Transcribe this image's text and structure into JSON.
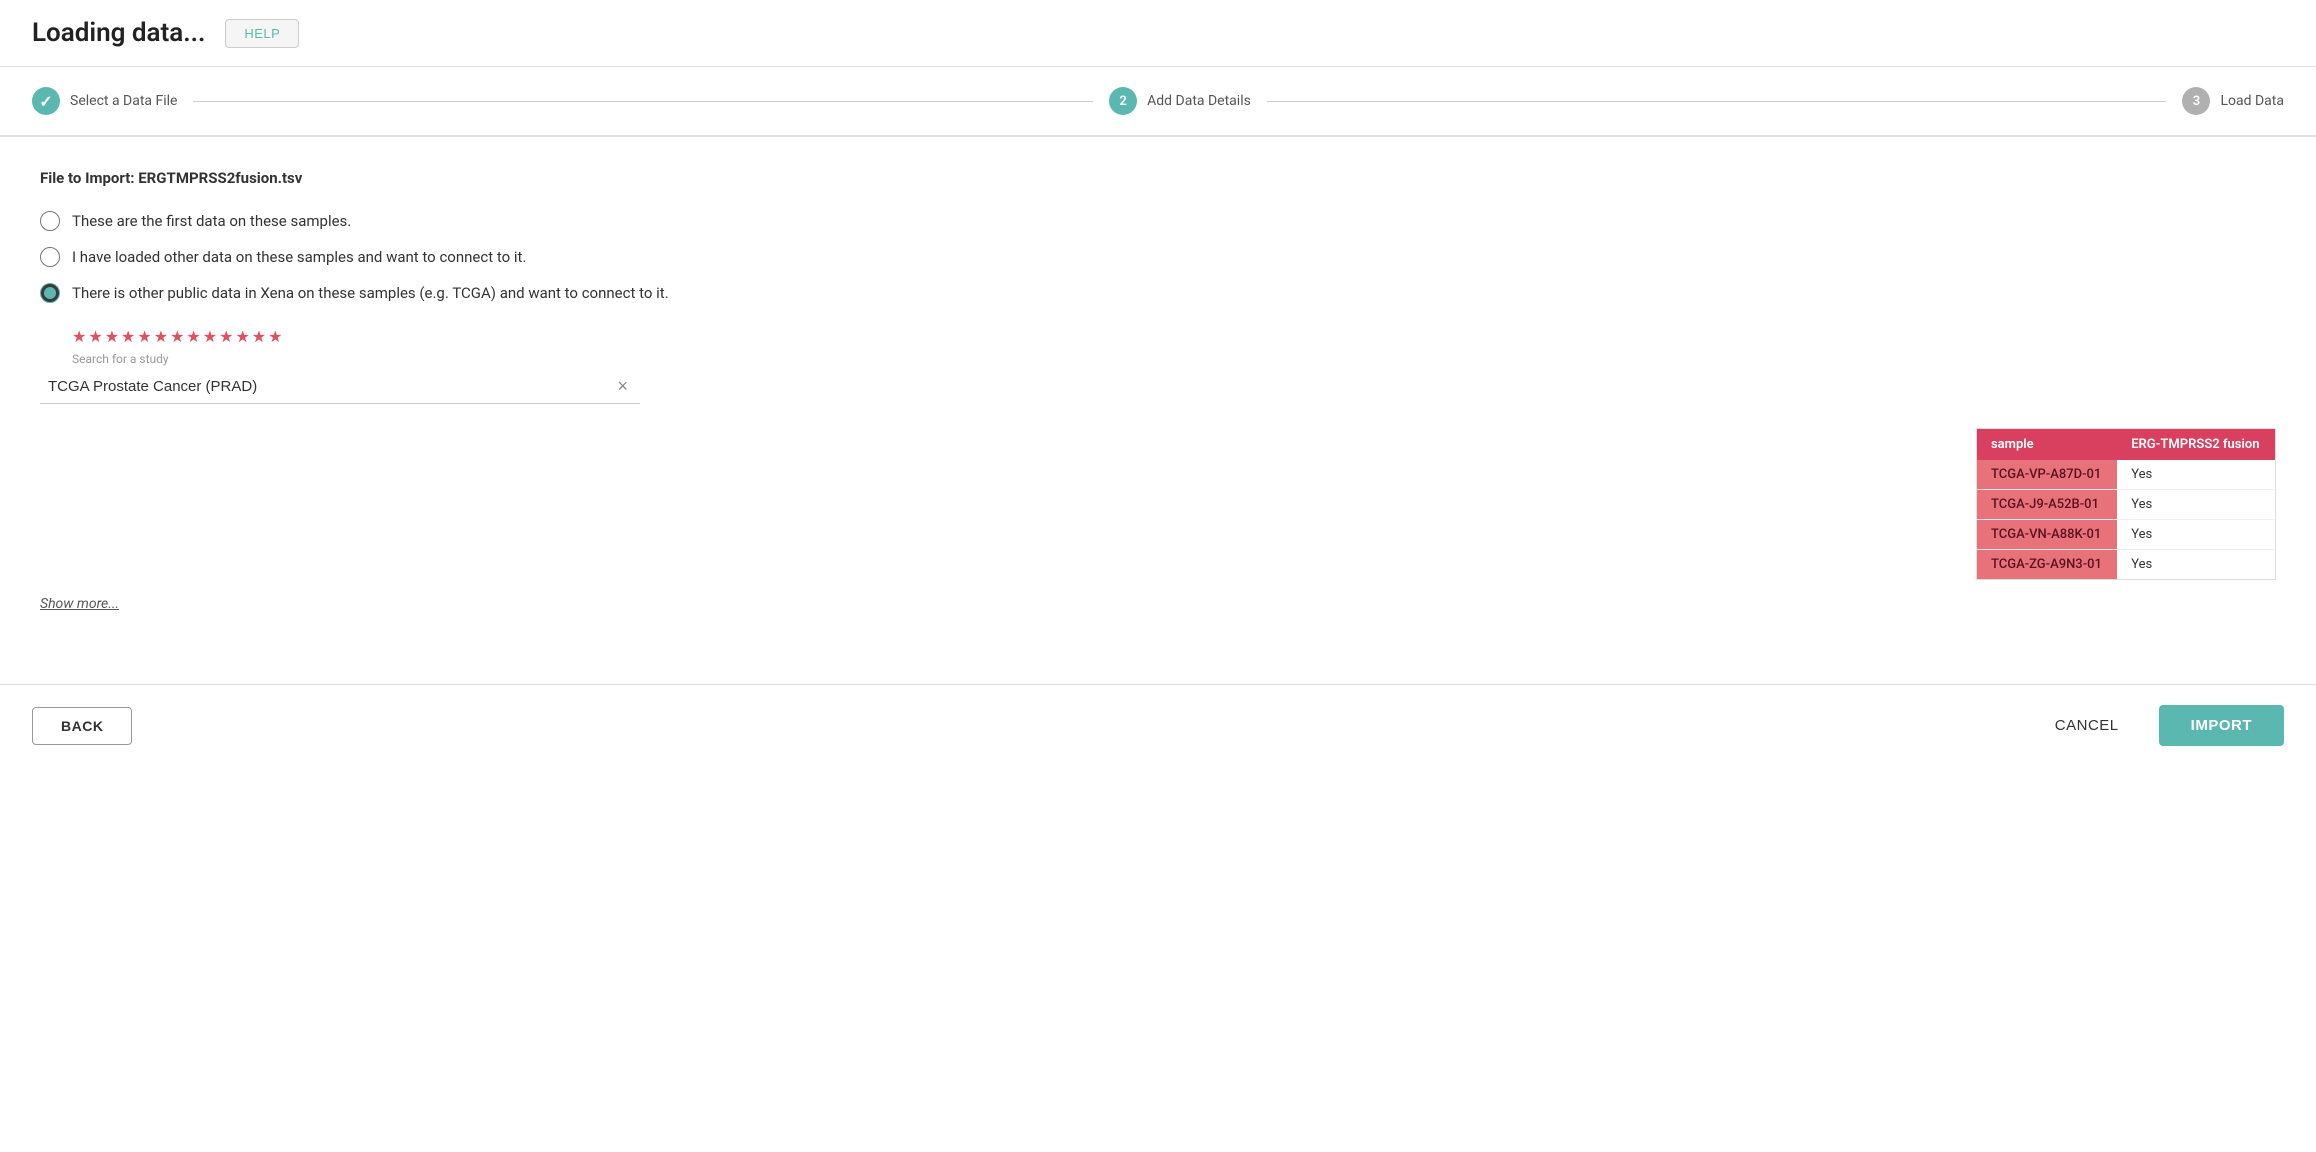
{
  "header": {
    "title": "Loading data...",
    "help_label": "HELP"
  },
  "stepper": {
    "steps": [
      {
        "id": "select-file",
        "label": "Select a Data File",
        "state": "done",
        "number": "✓"
      },
      {
        "id": "add-details",
        "label": "Add Data Details",
        "state": "active",
        "number": "2"
      },
      {
        "id": "load-data",
        "label": "Load Data",
        "state": "inactive",
        "number": "3"
      }
    ]
  },
  "main": {
    "file_import_label": "File to Import: ERGTMPRSS2fusion.tsv",
    "radio_options": [
      {
        "id": "first-data",
        "label": "These are the first data on these samples.",
        "checked": false
      },
      {
        "id": "other-data",
        "label": "I have loaded other data on these samples and want to connect to it.",
        "checked": false
      },
      {
        "id": "public-data",
        "label": "There is other public data in Xena on these samples (e.g. TCGA) and want to connect to it.",
        "checked": true
      }
    ],
    "stars": "★★★★★★★★★★★★★",
    "search_label": "Search for a study",
    "search_value": "TCGA Prostate Cancer (PRAD)",
    "clear_button_label": "×",
    "table": {
      "headers": [
        "sample",
        "ERG-TMPRSS2 fusion"
      ],
      "rows": [
        [
          "TCGA-VP-A87D-01",
          "Yes"
        ],
        [
          "TCGA-J9-A52B-01",
          "Yes"
        ],
        [
          "TCGA-VN-A88K-01",
          "Yes"
        ],
        [
          "TCGA-ZG-A9N3-01",
          "Yes"
        ]
      ]
    },
    "show_more_label": "Show more..."
  },
  "footer": {
    "back_label": "BACK",
    "cancel_label": "CANCEL",
    "import_label": "IMPORT"
  }
}
